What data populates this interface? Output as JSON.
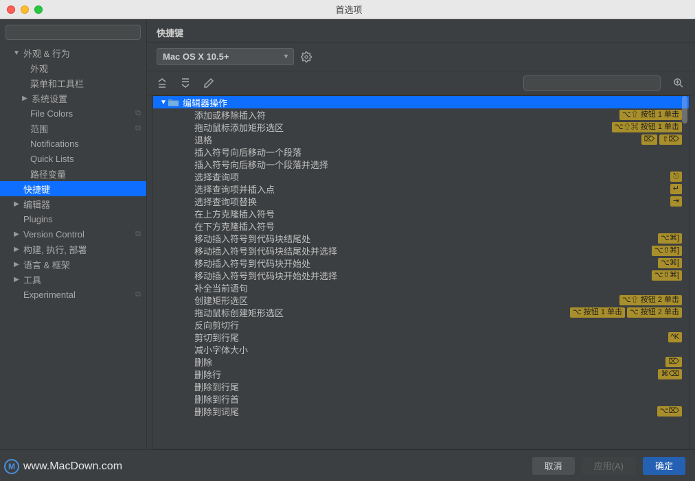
{
  "window_title": "首选项",
  "sidebar_search_placeholder": "",
  "sidebar": [
    {
      "label": "外观 & 行为",
      "level": "l1",
      "arrow": "▼"
    },
    {
      "label": "外观",
      "level": "l2"
    },
    {
      "label": "菜单和工具栏",
      "level": "l2"
    },
    {
      "label": "系统设置",
      "level": "l2a",
      "arrow": "▶"
    },
    {
      "label": "File Colors",
      "level": "l2",
      "copy": true
    },
    {
      "label": "范围",
      "level": "l2",
      "copy": true
    },
    {
      "label": "Notifications",
      "level": "l2"
    },
    {
      "label": "Quick Lists",
      "level": "l2"
    },
    {
      "label": "路径变量",
      "level": "l2"
    },
    {
      "label": "快捷键",
      "level": "l1",
      "selected": true
    },
    {
      "label": "编辑器",
      "level": "l1",
      "arrow": "▶"
    },
    {
      "label": "Plugins",
      "level": "l1"
    },
    {
      "label": "Version Control",
      "level": "l1",
      "arrow": "▶",
      "copy": true
    },
    {
      "label": "构建, 执行, 部署",
      "level": "l1",
      "arrow": "▶"
    },
    {
      "label": "语言 & 框架",
      "level": "l1",
      "arrow": "▶"
    },
    {
      "label": "工具",
      "level": "l1",
      "arrow": "▶"
    },
    {
      "label": "Experimental",
      "level": "l1",
      "copy": true
    }
  ],
  "content_title": "快捷键",
  "scheme_value": "Mac OS X 10.5+",
  "action_search_placeholder": "",
  "tree_header": "编辑器操作",
  "actions": [
    {
      "label": "添加或移除插入符",
      "sc": [
        "⌥⇧ 按钮 1 单击"
      ]
    },
    {
      "label": "拖动鼠标添加矩形选区",
      "sc": [
        "⌥⇧⌘ 按钮 1 单击"
      ]
    },
    {
      "label": "退格",
      "sc": [
        "⌦",
        "⇧⌦"
      ]
    },
    {
      "label": "插入符号向后移动一个段落"
    },
    {
      "label": "插入符号向后移动一个段落并选择"
    },
    {
      "label": "选择查询项",
      "sc": [
        "⎋"
      ]
    },
    {
      "label": "选择查询项并插入点",
      "sc": [
        "↵"
      ]
    },
    {
      "label": "选择查询项替换",
      "sc": [
        "⇥"
      ]
    },
    {
      "label": "在上方克隆插入符号"
    },
    {
      "label": "在下方克隆插入符号"
    },
    {
      "label": "移动插入符号到代码块结尾处",
      "sc": [
        "⌥⌘]"
      ]
    },
    {
      "label": "移动插入符号到代码块结尾处并选择",
      "sc": [
        "⌥⇧⌘]"
      ]
    },
    {
      "label": "移动插入符号到代码块开始处",
      "sc": [
        "⌥⌘["
      ]
    },
    {
      "label": "移动插入符号到代码块开始处并选择",
      "sc": [
        "⌥⇧⌘["
      ]
    },
    {
      "label": "补全当前语句"
    },
    {
      "label": "创建矩形选区",
      "sc": [
        "⌥⇧ 按钮 2 单击"
      ]
    },
    {
      "label": "拖动鼠标创建矩形选区",
      "sc": [
        "⌥ 按钮 1 单击",
        "⌥ 按钮 2 单击"
      ]
    },
    {
      "label": "反向剪切行"
    },
    {
      "label": "剪切到行尾",
      "sc": [
        "^K"
      ]
    },
    {
      "label": "减小字体大小"
    },
    {
      "label": "删除",
      "sc": [
        "⌦"
      ]
    },
    {
      "label": "删除行",
      "sc": [
        "⌘⌫"
      ]
    },
    {
      "label": "删除到行尾"
    },
    {
      "label": "删除到行首"
    },
    {
      "label": "删除到词尾",
      "sc": [
        "⌥⌦"
      ]
    }
  ],
  "buttons": {
    "cancel": "取消",
    "apply": "应用(A)",
    "ok": "确定"
  },
  "watermark": "www.MacDown.com"
}
